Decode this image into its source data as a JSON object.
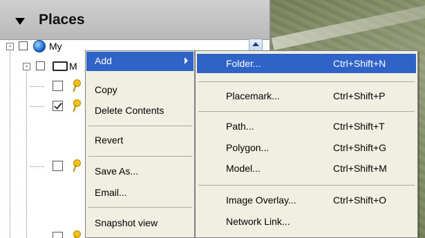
{
  "panel": {
    "title": "Places",
    "tree": {
      "root_label": "My",
      "child_label": "M"
    }
  },
  "context_menu": {
    "items": [
      {
        "label": "Add",
        "has_submenu": true,
        "highlighted": true
      },
      {
        "label": "Copy"
      },
      {
        "label": "Delete Contents"
      },
      {
        "label": "Revert"
      },
      {
        "label": "Save As..."
      },
      {
        "label": "Email..."
      },
      {
        "label": "Snapshot view"
      }
    ]
  },
  "add_submenu": {
    "items": [
      {
        "label": "Folder...",
        "shortcut": "Ctrl+Shift+N",
        "highlighted": true
      },
      {
        "label": "Placemark...",
        "shortcut": "Ctrl+Shift+P"
      },
      {
        "label": "Path...",
        "shortcut": "Ctrl+Shift+T"
      },
      {
        "label": "Polygon...",
        "shortcut": "Ctrl+Shift+G"
      },
      {
        "label": "Model...",
        "shortcut": "Ctrl+Shift+M"
      },
      {
        "label": "Image Overlay...",
        "shortcut": "Ctrl+Shift+O"
      },
      {
        "label": "Network Link...",
        "shortcut": ""
      }
    ]
  },
  "colors": {
    "highlight": "#2f63c8",
    "menu_bg": "#f1efe2",
    "header_bg": "#c4c4c4"
  }
}
